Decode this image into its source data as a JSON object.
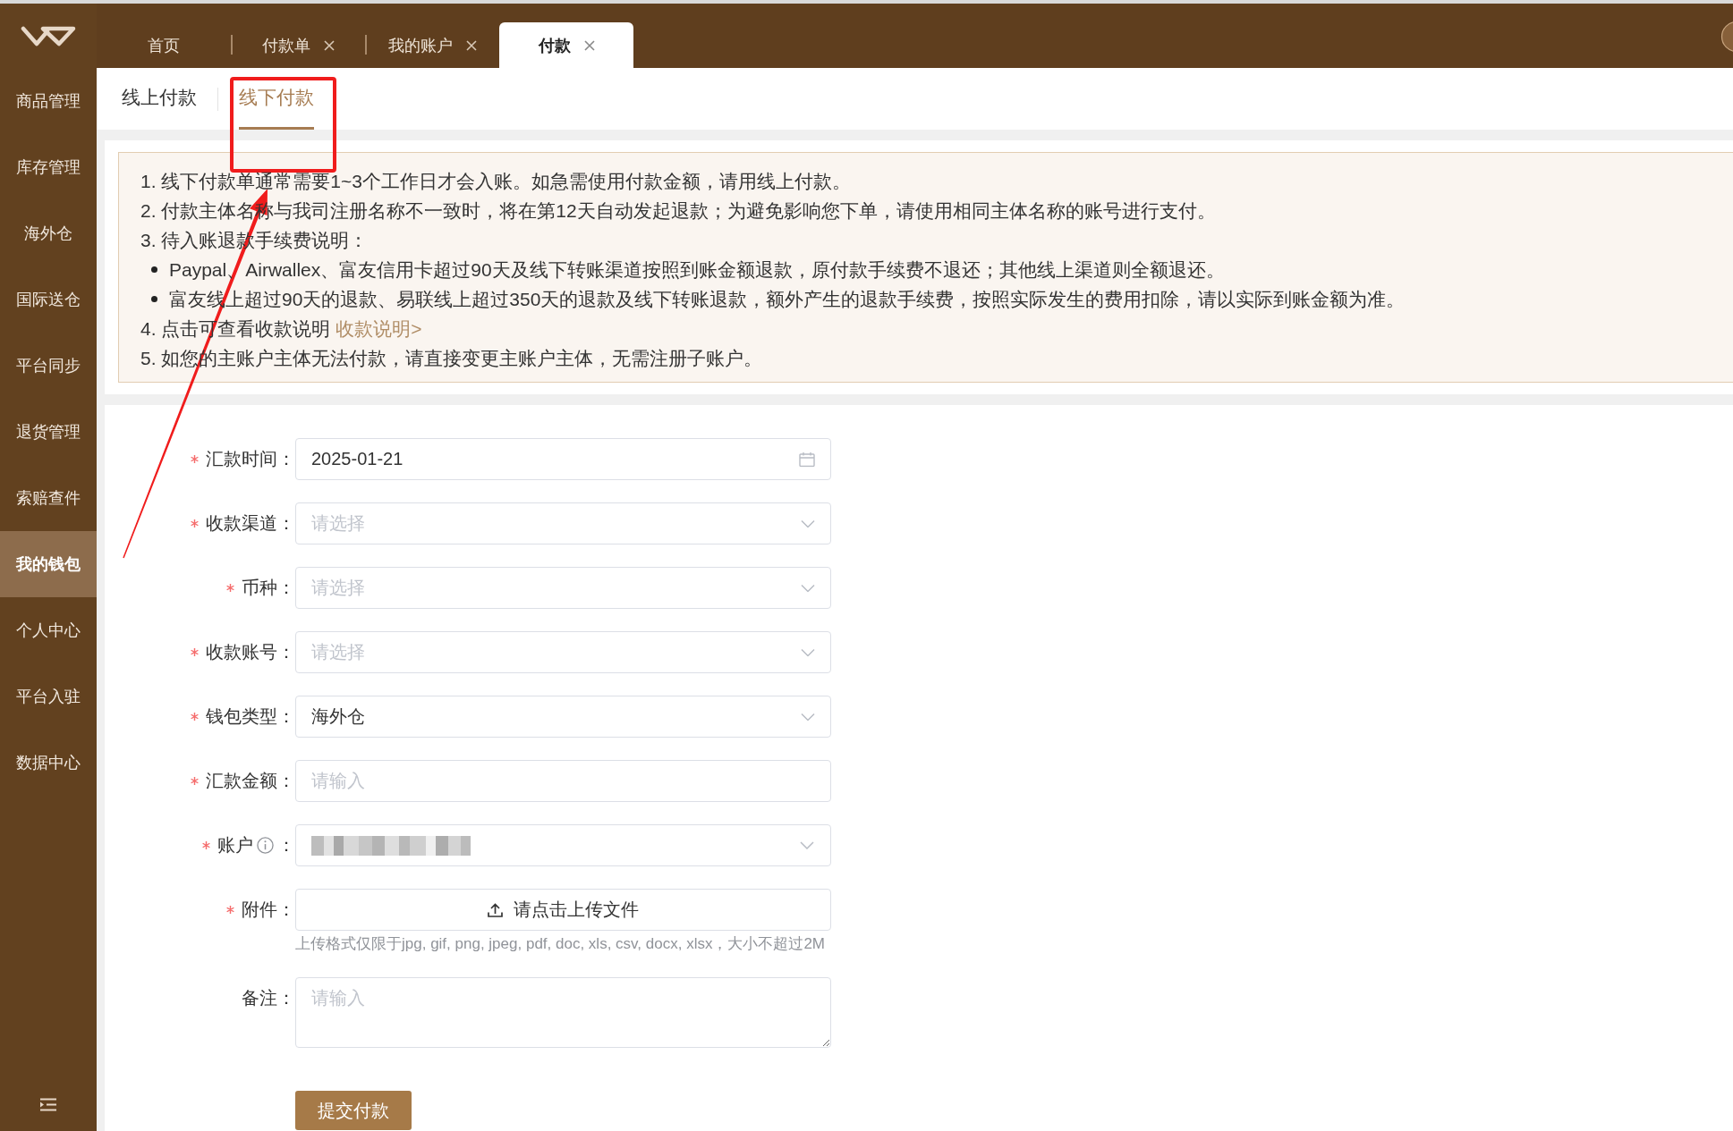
{
  "header": {
    "tabs": [
      {
        "label": "首页",
        "closable": false,
        "selected": false
      },
      {
        "label": "付款单",
        "closable": true,
        "selected": false
      },
      {
        "label": "我的账户",
        "closable": true,
        "selected": false
      },
      {
        "label": "付款",
        "closable": true,
        "selected": true
      }
    ]
  },
  "sidebar": {
    "items": [
      {
        "label": "商品管理",
        "selected": false
      },
      {
        "label": "库存管理",
        "selected": false
      },
      {
        "label": "海外仓",
        "selected": false
      },
      {
        "label": "国际送仓",
        "selected": false
      },
      {
        "label": "平台同步",
        "selected": false
      },
      {
        "label": "退货管理",
        "selected": false
      },
      {
        "label": "索赔查件",
        "selected": false
      },
      {
        "label": "我的钱包",
        "selected": true
      },
      {
        "label": "个人中心",
        "selected": false
      },
      {
        "label": "平台入驻",
        "selected": false
      },
      {
        "label": "数据中心",
        "selected": false
      }
    ]
  },
  "subtabs": [
    {
      "label": "线上付款",
      "selected": false
    },
    {
      "label": "线下付款",
      "selected": true
    }
  ],
  "notice": {
    "lines": [
      {
        "kind": "item",
        "text": "1. 线下付款单通常需要1~3个工作日才会入账。如急需使用付款金额，请用线上付款。"
      },
      {
        "kind": "item",
        "text": "2. 付款主体名称与我司注册名称不一致时，将在第12天自动发起退款；为避免影响您下单，请使用相同主体名称的账号进行支付。"
      },
      {
        "kind": "item",
        "text": "3. 待入账退款手续费说明："
      },
      {
        "kind": "bullet",
        "text": "Paypal、Airwallex、富友信用卡超过90天及线下转账渠道按照到账金额退款，原付款手续费不退还；其他线上渠道则全额退还。"
      },
      {
        "kind": "bullet",
        "text": "富友线上超过90天的退款、易联线上超过350天的退款及线下转账退款，额外产生的退款手续费，按照实际发生的费用扣除，请以实际到账金额为准。"
      },
      {
        "kind": "item",
        "text": "4. 点击可查看收款说明",
        "link": "收款说明>"
      },
      {
        "kind": "item",
        "text": "5. 如您的主账户主体无法付款，请直接变更主账户主体，无需注册子账户。"
      }
    ]
  },
  "form": {
    "fields": [
      {
        "kind": "date",
        "label": "汇款时间：",
        "required": true,
        "value": "2025-01-21"
      },
      {
        "kind": "select",
        "label": "收款渠道：",
        "required": true,
        "placeholder": "请选择"
      },
      {
        "kind": "select",
        "label": "币种：",
        "required": true,
        "placeholder": "请选择"
      },
      {
        "kind": "select",
        "label": "收款账号：",
        "required": true,
        "placeholder": "请选择"
      },
      {
        "kind": "select",
        "label": "钱包类型：",
        "required": true,
        "value": "海外仓"
      },
      {
        "kind": "input",
        "label": "汇款金额：",
        "required": true,
        "placeholder": "请输入"
      },
      {
        "kind": "select",
        "label": "账户",
        "info": true,
        "suffix": "：",
        "required": true,
        "redacted": true
      },
      {
        "kind": "upload",
        "label": "附件：",
        "required": true,
        "button": "请点击上传文件",
        "hint": "上传格式仅限于jpg, gif, png, jpeg, pdf, doc, xls, csv, docx, xlsx，大小不超过2M"
      },
      {
        "kind": "textarea",
        "label": "备注：",
        "required": false,
        "placeholder": "请输入"
      }
    ],
    "submit": "提交付款"
  },
  "annotation": {
    "box": true,
    "arrow": true
  }
}
